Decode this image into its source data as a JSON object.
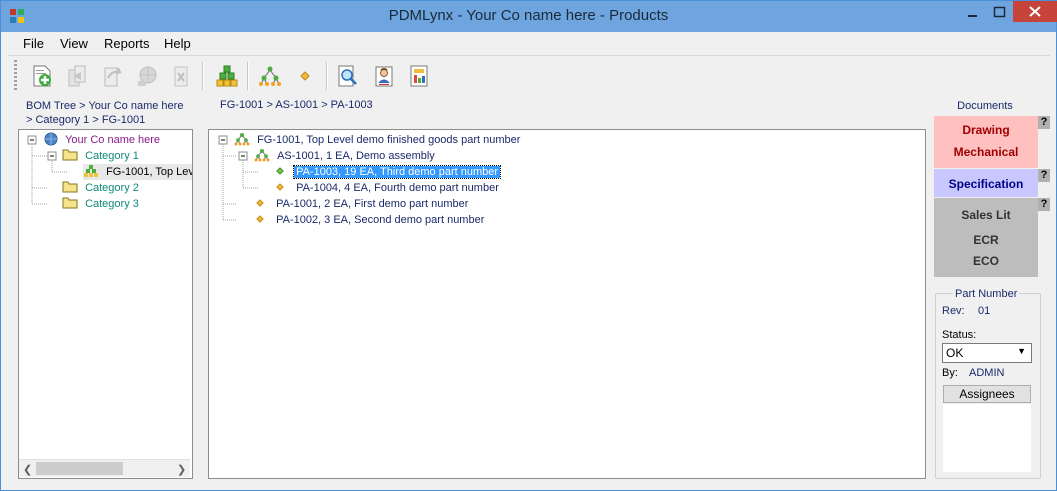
{
  "window": {
    "title": "PDMLynx - Your Co name here - Products"
  },
  "menu": {
    "items": [
      "File",
      "View",
      "Reports",
      "Help"
    ]
  },
  "toolbar": {
    "icons": [
      "new-part-icon",
      "copy-icon",
      "forward-icon",
      "globe-icon",
      "delete-icon",
      "bom-icon",
      "tree-icon",
      "part-icon",
      "search-doc-icon",
      "user-icon",
      "report-icon"
    ]
  },
  "left": {
    "breadcrumb_line1": "BOM Tree > Your Co name here",
    "breadcrumb_line2": "> Category 1 > FG-1001",
    "tree": {
      "root": "Your Co name here",
      "cat1": "Category 1",
      "fg": "FG-1001, Top Lev",
      "cat2": "Category 2",
      "cat3": "Category 3"
    }
  },
  "bom": {
    "breadcrumb": "FG-1001 > AS-1001 > PA-1003",
    "nodes": {
      "fg": "FG-1001, Top Level demo finished goods part number",
      "as": "AS-1001, 1 EA, Demo assembly",
      "pa1003": "PA-1003, 19 EA, Third demo part number",
      "pa1004": "PA-1004, 4 EA, Fourth demo part number",
      "pa1001": "PA-1001, 2 EA, First demo part number",
      "pa1002": "PA-1002, 3 EA, Second demo part number"
    }
  },
  "documents": {
    "title": "Documents",
    "drawing": "Drawing",
    "mechanical": "Mechanical",
    "specification": "Specification",
    "sales_lit": "Sales Lit",
    "ecr": "ECR",
    "eco": "ECO",
    "help": "?",
    "colors": {
      "drawing_bg": "#ffc0c0",
      "drawing_text": "#a00000",
      "spec_bg": "#c8c8ff",
      "spec_text": "#00008b",
      "sales_bg": "#bdbdbd",
      "sales_text": "#333333"
    }
  },
  "part": {
    "title": "Part Number",
    "rev_label": "Rev:",
    "rev_value": "01",
    "status_label": "Status:",
    "status_value": "OK",
    "by_label": "By:",
    "by_value": "ADMIN",
    "assignees": "Assignees"
  }
}
